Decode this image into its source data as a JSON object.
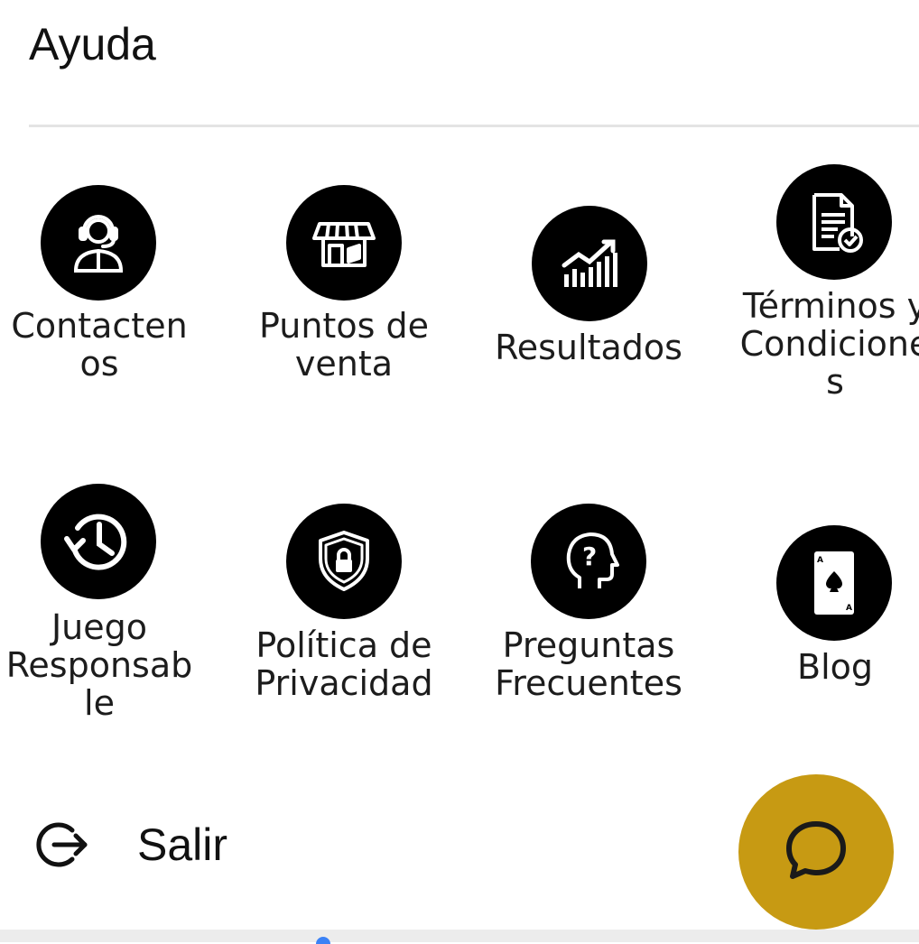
{
  "header": {
    "title": "Ayuda"
  },
  "tiles": [
    {
      "label": "Contacten\nos",
      "icon": "customer-support-icon"
    },
    {
      "label": "Puntos de\nventa",
      "icon": "store-icon"
    },
    {
      "label": "Resultados",
      "icon": "chart-growth-icon"
    },
    {
      "label": "Términos y\nCondicione\ns",
      "icon": "document-check-icon"
    },
    {
      "label": "Juego\nResponsab\nle",
      "icon": "history-clock-icon"
    },
    {
      "label": "Política de\nPrivacidad",
      "icon": "shield-lock-icon"
    },
    {
      "label": "Preguntas\nFrecuentes",
      "icon": "head-question-icon"
    },
    {
      "label": "Blog",
      "icon": "playing-card-icon"
    }
  ],
  "footer": {
    "logout_label": "Salir"
  },
  "colors": {
    "accent": "#c79a13",
    "icon_bg": "#000000"
  }
}
